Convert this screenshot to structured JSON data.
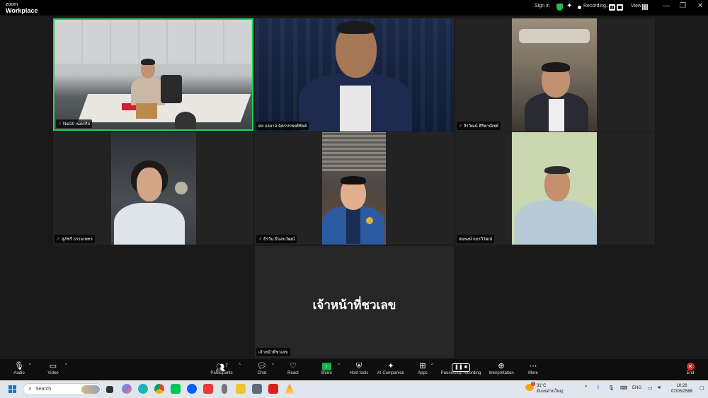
{
  "app": {
    "brand_top": "zoom",
    "brand_name": "Workplace"
  },
  "titlebar": {
    "sign_in": "Sign in",
    "recording": "Recording...",
    "view": "View",
    "minimize_glyph": "—",
    "restore_glyph": "❐",
    "close_glyph": "✕"
  },
  "tiles": [
    {
      "name": "Nat10 เนตรกิจ",
      "active": true
    },
    {
      "name": "ศล องอาจ ฉัตรปรพงศ์ชัยค์"
    },
    {
      "name": "จิรวัฒน์ ศิริพาณิชย์"
    },
    {
      "name": "สุภัชรี ธรรมเพชร"
    },
    {
      "name": "ธีรวัน ธีนอนวัฒน์"
    },
    {
      "name": "สมพงษ์ อมรวิวัฒน์"
    },
    {
      "name": "เจ้าหน้าที่ชวเลข",
      "display_name": "เจ้าหน้าที่ชวเลข"
    }
  ],
  "toolbar": {
    "audio": "Audio",
    "video": "Video",
    "participants": "Participants",
    "participants_count": "7",
    "chat": "Chat",
    "react": "React",
    "share": "Share",
    "host_tools": "Host tools",
    "ai_companion": "AI Companion",
    "apps": "Apps",
    "pause_stop": "Pause/stop recording",
    "interpretation": "Interpretation",
    "more": "More",
    "end": "End"
  },
  "taskbar": {
    "search_placeholder": "Search",
    "weather_temp": "31°C",
    "weather_desc": "มีเมฆส่วนใหญ่",
    "weather_badge": "1",
    "language": "ENG",
    "time": "10:26",
    "date": "07/05/2568"
  },
  "colors": {
    "active_border": "#23d160",
    "share_green": "#18b04a",
    "end_red": "#e02828"
  }
}
